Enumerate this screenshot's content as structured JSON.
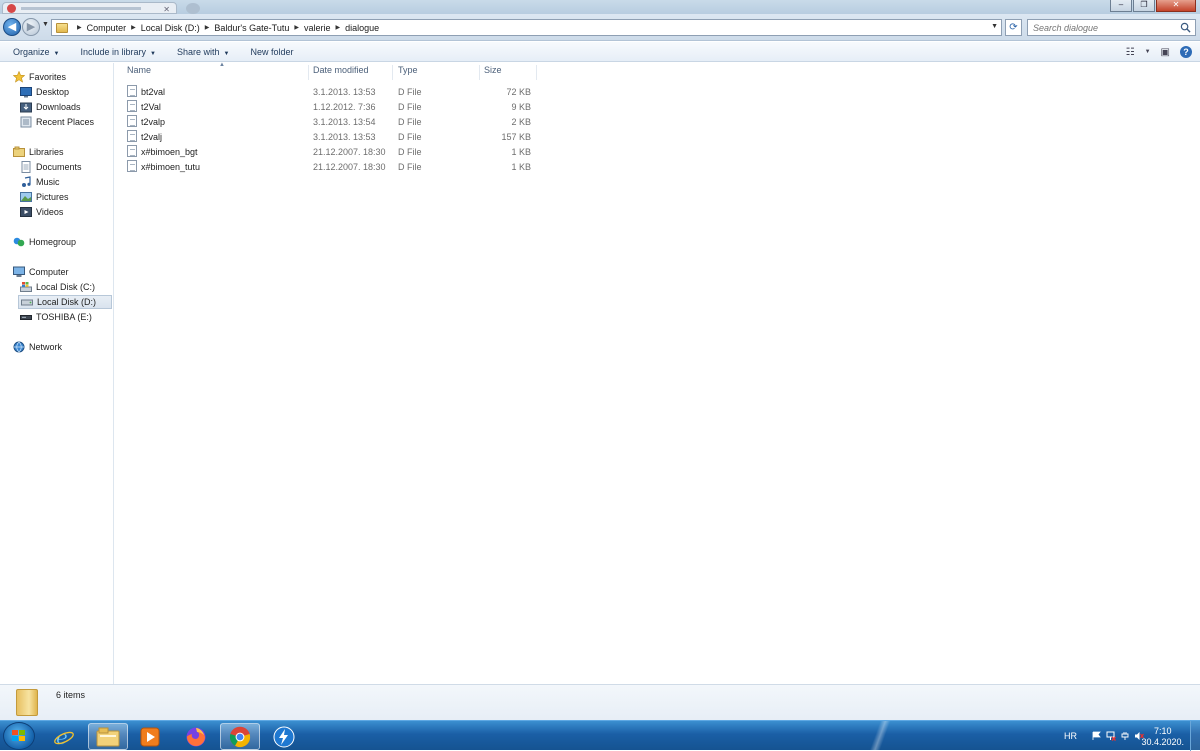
{
  "address": {
    "crumbs": [
      "Computer",
      "Local Disk (D:)",
      "Baldur's Gate-Tutu",
      "valerie",
      "dialogue"
    ]
  },
  "search": {
    "placeholder": "Search dialogue"
  },
  "toolbar": {
    "organize": "Organize",
    "include_in_library": "Include in library",
    "share_with": "Share with",
    "new_folder": "New folder"
  },
  "nav": {
    "favorites": "Favorites",
    "desktop": "Desktop",
    "downloads": "Downloads",
    "recent_places": "Recent Places",
    "libraries": "Libraries",
    "documents": "Documents",
    "music": "Music",
    "pictures": "Pictures",
    "videos": "Videos",
    "homegroup": "Homegroup",
    "computer": "Computer",
    "local_c": "Local Disk (C:)",
    "local_d": "Local Disk (D:)",
    "toshiba": "TOSHIBA (E:)",
    "network": "Network"
  },
  "columns": {
    "name": "Name",
    "date": "Date modified",
    "type": "Type",
    "size": "Size"
  },
  "files": [
    {
      "name": "bt2val",
      "date": "3.1.2013. 13:53",
      "type": "D File",
      "size": "72 KB"
    },
    {
      "name": "t2Val",
      "date": "1.12.2012. 7:36",
      "type": "D File",
      "size": "9 KB"
    },
    {
      "name": "t2valp",
      "date": "3.1.2013. 13:54",
      "type": "D File",
      "size": "2 KB"
    },
    {
      "name": "t2valj",
      "date": "3.1.2013. 13:53",
      "type": "D File",
      "size": "157 KB"
    },
    {
      "name": "x#bimoen_bgt",
      "date": "21.12.2007. 18:30",
      "type": "D File",
      "size": "1 KB"
    },
    {
      "name": "x#bimoen_tutu",
      "date": "21.12.2007. 18:30",
      "type": "D File",
      "size": "1 KB"
    }
  ],
  "status": {
    "item_count": "6 items"
  },
  "taskbar": {
    "language": "HR",
    "time": "7:10",
    "date": "30.4.2020."
  },
  "colors": {
    "accent": "#1e395b",
    "taskbar": "#1a5fa6"
  }
}
